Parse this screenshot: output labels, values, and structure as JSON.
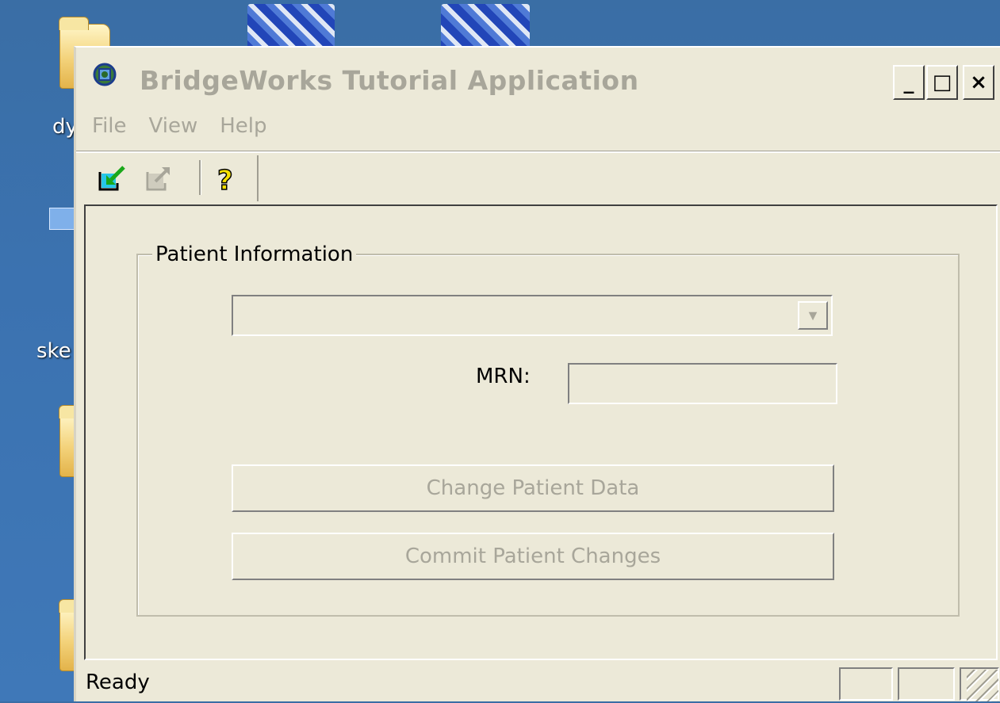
{
  "desktop": {
    "label_1": "dy",
    "label_2": "ske"
  },
  "window": {
    "title": "BridgeWorks Tutorial Application",
    "minimize_label": "_",
    "maximize_label": "□",
    "close_label": "×"
  },
  "menu": {
    "items": [
      {
        "label": "File"
      },
      {
        "label": "View"
      },
      {
        "label": "Help"
      }
    ]
  },
  "toolbar": {
    "buttons": [
      {
        "icon": "import-arrow-icon",
        "enabled": true
      },
      {
        "icon": "export-arrow-icon",
        "enabled": false
      },
      {
        "icon": "help-icon",
        "enabled": true
      }
    ]
  },
  "patient_group": {
    "title": "Patient Information",
    "patient_select_value": "",
    "mrn_label": "MRN:",
    "mrn_value": "",
    "change_button_label": "Change Patient Data",
    "commit_button_label": "Commit Patient Changes"
  },
  "status": {
    "text": "Ready"
  }
}
